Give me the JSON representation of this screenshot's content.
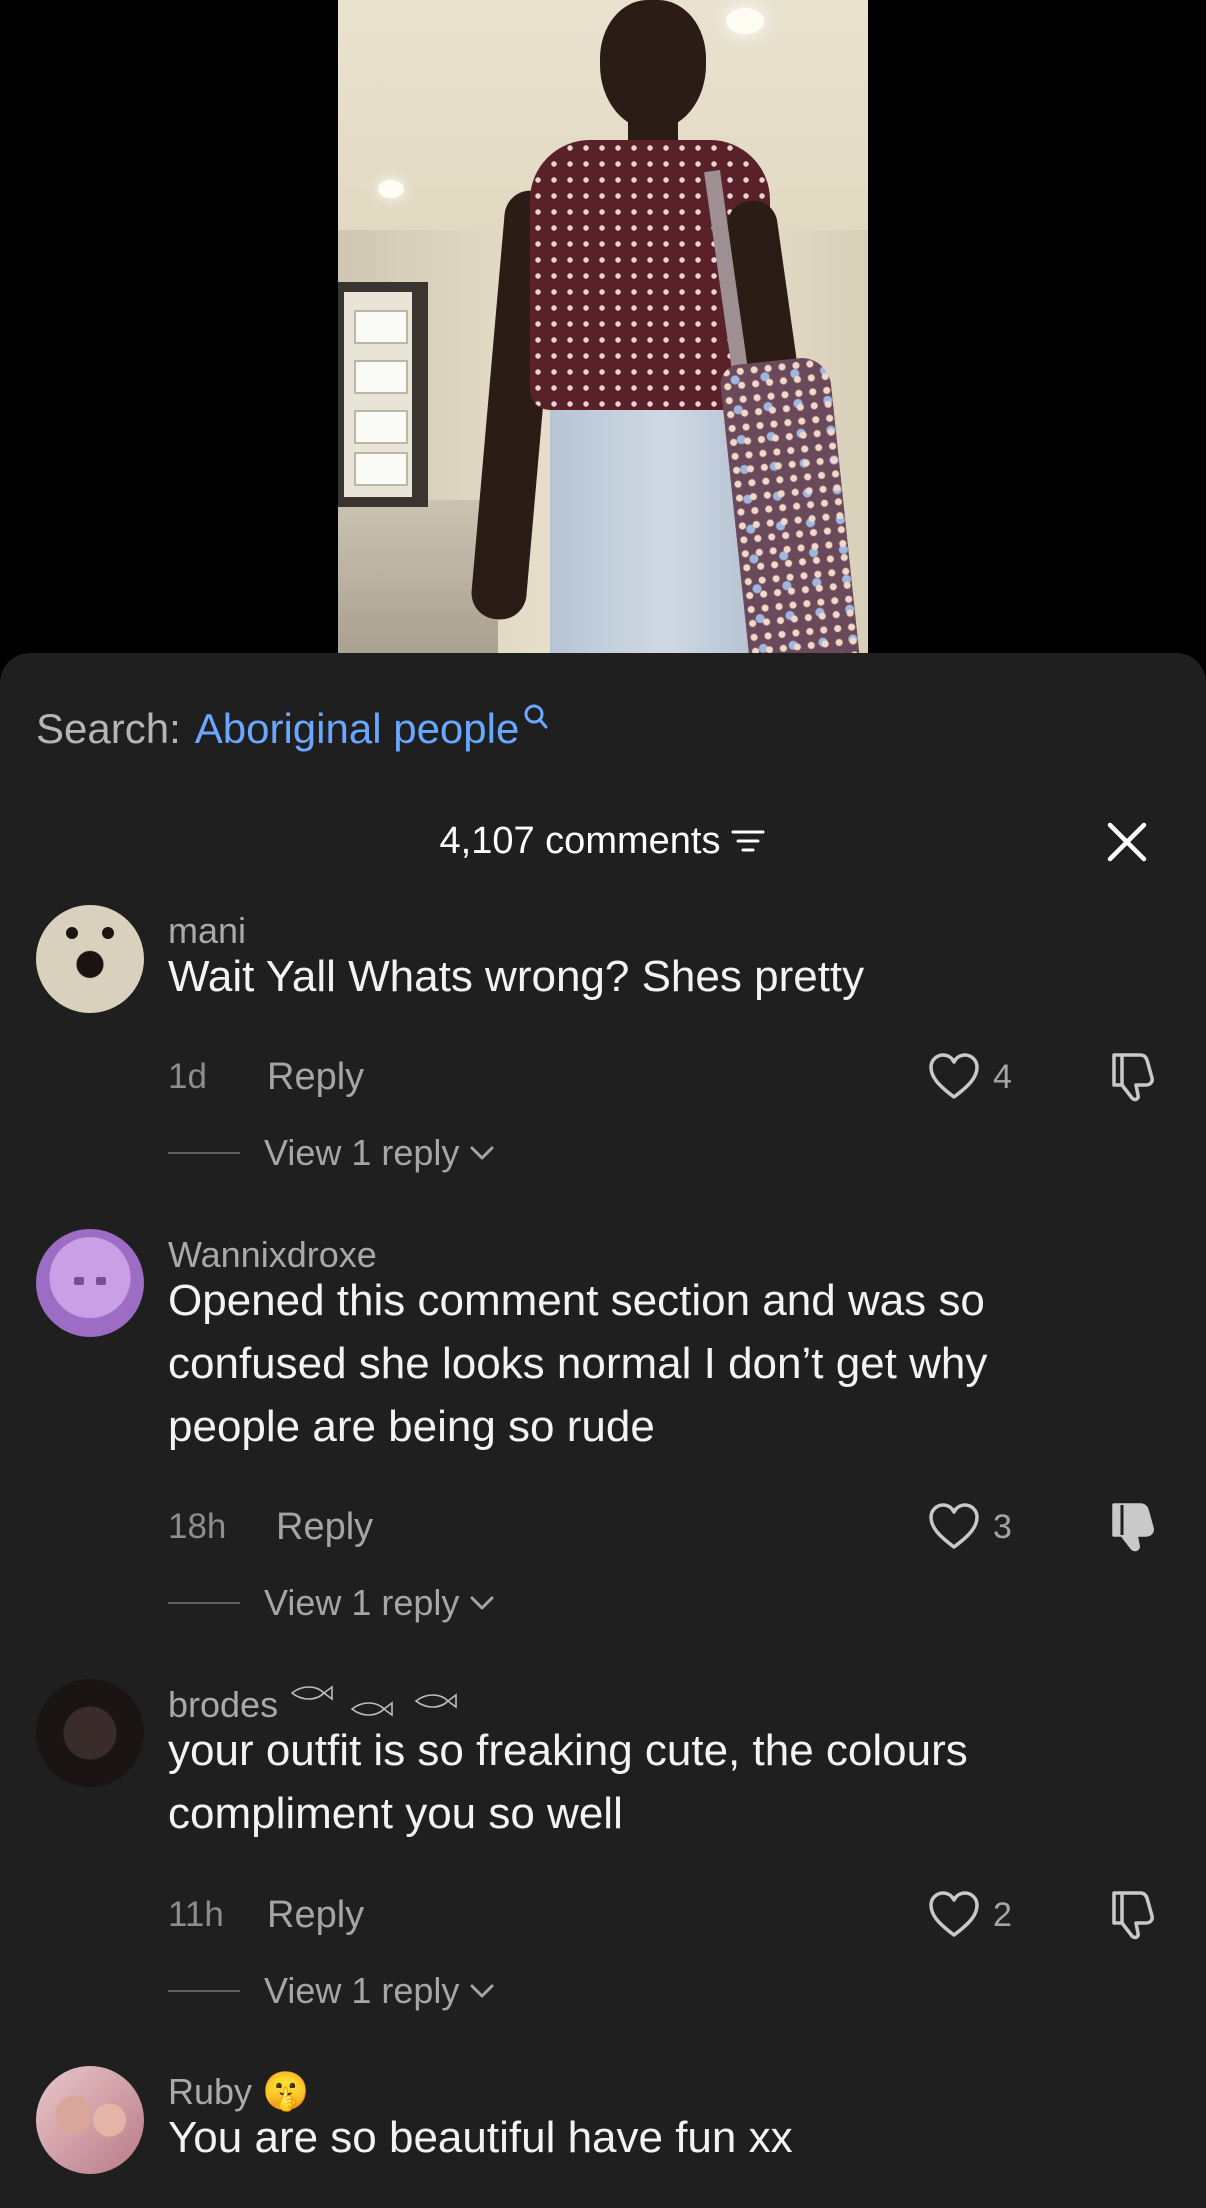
{
  "search": {
    "prefix": "Search:",
    "term": "Aboriginal people"
  },
  "header": {
    "count_label": "4,107 comments"
  },
  "icons": {
    "search": "search-icon",
    "sort": "sort-icon",
    "close": "close-icon",
    "like": "heart-icon",
    "dislike": "thumbs-down-icon",
    "chevron": "chevron-down-icon"
  },
  "colors": {
    "sheet_bg": "#1f1f1f",
    "search_term": "#6aa7ff",
    "muted_text": "#a5a5a5"
  },
  "comments": [
    {
      "username": "mani",
      "text": "Wait Yall Whats wrong? Shes pretty",
      "time": "1d",
      "reply_label": "Reply",
      "likes": "4",
      "view_replies": "View 1 reply"
    },
    {
      "username": "Wannixdroxe",
      "text": "Opened this comment section and was so confused she looks normal I don’t get why people are being so rude",
      "time": "18h",
      "reply_label": "Reply",
      "likes": "3",
      "view_replies": "View 1 reply"
    },
    {
      "username": "brodes",
      "text": "your outfit is so freaking cute, the colours compliment you so well",
      "time": "11h",
      "reply_label": "Reply",
      "likes": "2",
      "view_replies": "View 1 reply"
    },
    {
      "username": "Ruby",
      "username_emoji": "🤫",
      "text": "You are so beautiful have fun xx"
    }
  ]
}
